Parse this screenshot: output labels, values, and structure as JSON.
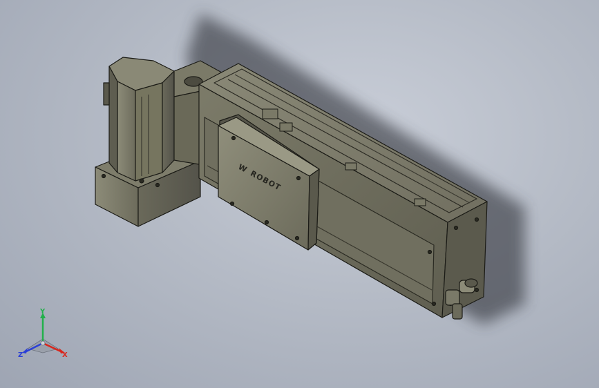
{
  "viewport": {
    "background_top": "#c9ced8",
    "background_bottom": "#9ea5b3"
  },
  "model": {
    "body_color": "#6f6e5e",
    "body_dark": "#4e4d41",
    "body_light": "#8d8c79",
    "edge_color": "#1b1b16",
    "logo_text": "ROBOT",
    "logo_mark": "W"
  },
  "triad": {
    "x_label": "X",
    "y_label": "Y",
    "z_label": "Z",
    "x_color": "#d9261c",
    "y_color": "#22b04b",
    "z_color": "#2b3fd6"
  }
}
